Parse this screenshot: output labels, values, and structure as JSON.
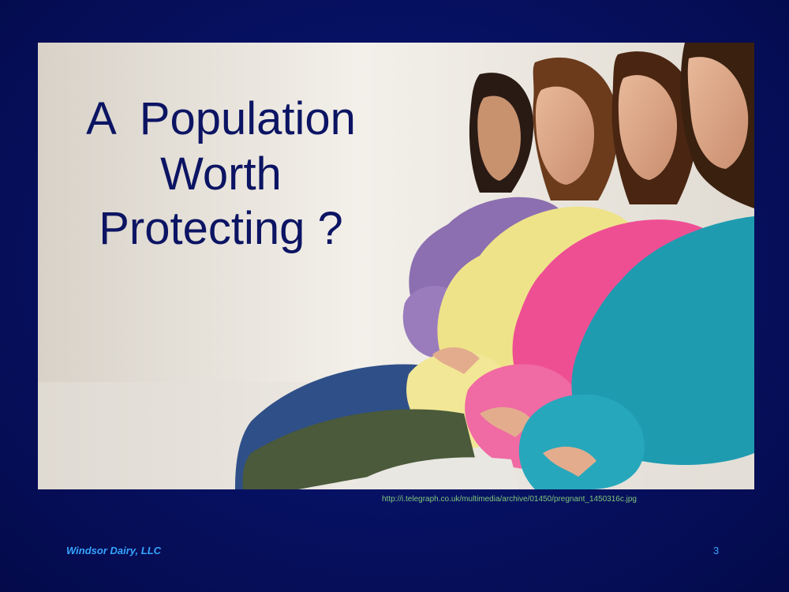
{
  "slide": {
    "title_lines": [
      "A  Population",
      "Worth",
      "Protecting ?"
    ],
    "image_source": "http://i.telegraph.co.uk/multimedia/archive/01450/pregnant_1450316c.jpg",
    "footer_text": "Windsor Dairy, LLC",
    "page_number": "3"
  },
  "photo": {
    "description_icon": "photo-pregnant-women",
    "shirt_colors": [
      "#8c6fb0",
      "#efe38a",
      "#ee4f93",
      "#1f9bb0"
    ]
  },
  "colors": {
    "background": "#071266",
    "title": "#0c1463",
    "footer": "#36a4ff",
    "source_link": "#7fc77a"
  }
}
